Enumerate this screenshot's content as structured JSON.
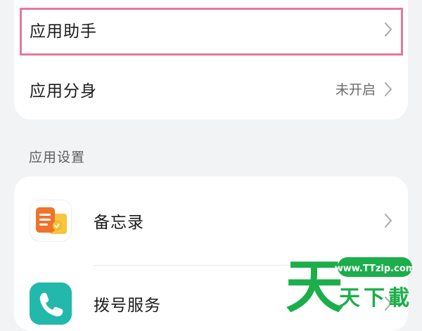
{
  "top_group": {
    "app_assistant": {
      "label": "应用助手"
    },
    "app_dual": {
      "label": "应用分身",
      "value": "未开启"
    }
  },
  "section": {
    "title": "应用设置"
  },
  "settings_list": [
    {
      "label": "备忘录",
      "icon": "memo-icon"
    },
    {
      "label": "拨号服务",
      "icon": "dialer-icon"
    }
  ],
  "watermark": {
    "big_char": "天",
    "url": "www.TTzip.com",
    "text": "天下載"
  },
  "colors": {
    "background": "#f1f3f5",
    "highlight": "#e4789e",
    "watermark_green": "#1cae4a"
  }
}
